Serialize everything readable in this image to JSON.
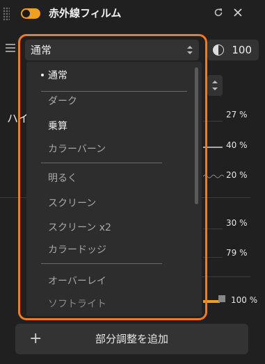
{
  "header": {
    "title": "赤外線フィルム",
    "enabled": true,
    "reset_icon": "reset-icon",
    "close_icon": "close-icon"
  },
  "blend": {
    "selected": "通常",
    "opacity": "100"
  },
  "background": {
    "partial_label": "ハイ",
    "percents": [
      "27 %",
      "40 %",
      "20 %",
      "30 %",
      "79 %",
      "100 %"
    ]
  },
  "dropdown": {
    "items": [
      "通常",
      "ダーク",
      "乗算",
      "カラーバーン",
      "明るく",
      "スクリーン",
      "スクリーン x2",
      "カラードッジ",
      "オーバーレイ",
      "ソフトライト"
    ]
  },
  "footer": {
    "plus": "+",
    "add_label": "部分調整を追加"
  },
  "colors": {
    "accent": "#f0a020",
    "highlight": "#f47a1f",
    "panel": "#202020"
  }
}
